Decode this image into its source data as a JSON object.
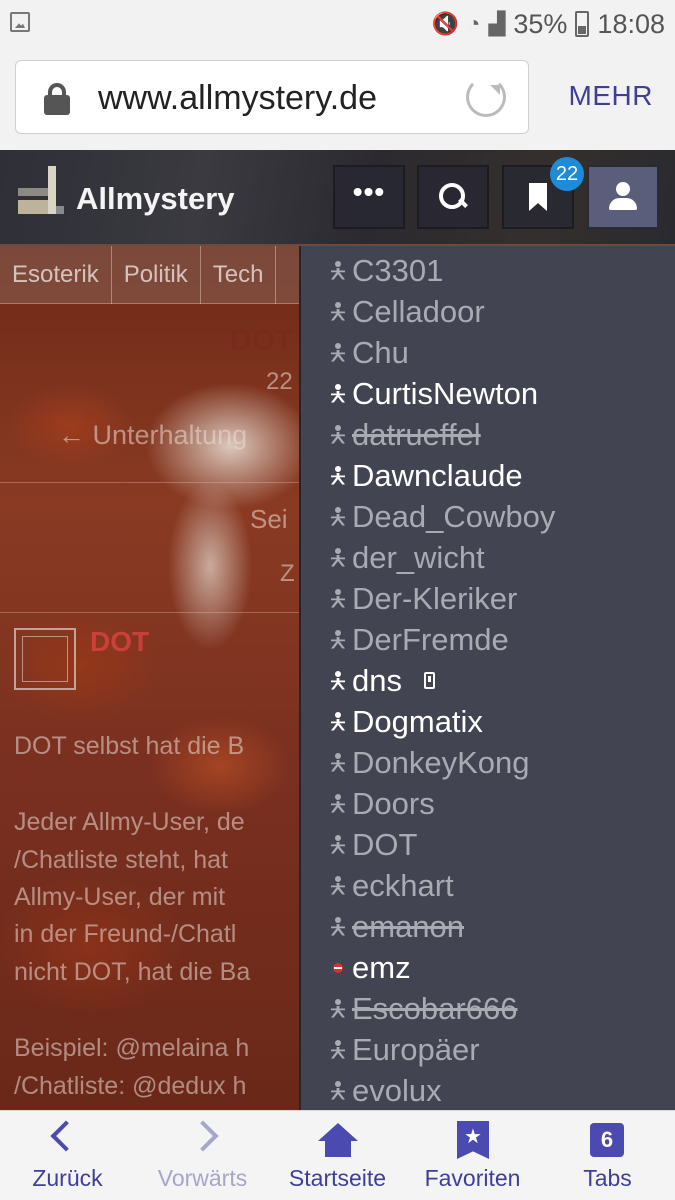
{
  "status_bar": {
    "battery": "35%",
    "time": "18:08"
  },
  "browser": {
    "url": "www.allmystery.de",
    "more_label": "MEHR"
  },
  "site": {
    "name": "Allmystery",
    "more_button": "•••",
    "notification_count": "22"
  },
  "page": {
    "categories": [
      "Esoterik",
      "Politik",
      "Tech"
    ],
    "thread_title_fragment": "DOT",
    "date_fragment": "22",
    "subforum_fragment": "← Unterhaltung",
    "pages_fragment": "Sei",
    "z_fragment": "Z",
    "post_author": "DOT",
    "post_lines": [
      "DOT selbst hat die B",
      "Jeder Allmy-User, de",
      "/Chatliste steht, hat",
      "Allmy-User, der mit",
      "in der Freund-/Chatl",
      "nicht DOT, hat die Ba",
      "Beispiel: @melaina h",
      "/Chatliste: @dedux h"
    ]
  },
  "user_list": [
    {
      "name": "C3301",
      "state": "offline"
    },
    {
      "name": "Celladoor",
      "state": "offline"
    },
    {
      "name": "Chu",
      "state": "offline"
    },
    {
      "name": "CurtisNewton",
      "state": "online"
    },
    {
      "name": "datrueffel",
      "state": "deleted"
    },
    {
      "name": "Dawnclaude",
      "state": "online"
    },
    {
      "name": "Dead_Cowboy",
      "state": "offline"
    },
    {
      "name": "der_wicht",
      "state": "offline"
    },
    {
      "name": "Der-Kleriker",
      "state": "offline"
    },
    {
      "name": "DerFremde",
      "state": "offline"
    },
    {
      "name": "dns",
      "state": "online",
      "mobile": true
    },
    {
      "name": "Dogmatix",
      "state": "online"
    },
    {
      "name": "DonkeyKong",
      "state": "offline"
    },
    {
      "name": "Doors",
      "state": "offline"
    },
    {
      "name": "DOT",
      "state": "offline"
    },
    {
      "name": "eckhart",
      "state": "offline"
    },
    {
      "name": "emanon",
      "state": "deleted"
    },
    {
      "name": "emz",
      "state": "busy"
    },
    {
      "name": "Escobar666",
      "state": "deleted"
    },
    {
      "name": "Europäer",
      "state": "offline"
    },
    {
      "name": "evolux",
      "state": "offline"
    }
  ],
  "bottom_nav": {
    "back": "Zurück",
    "forward": "Vorwärts",
    "home": "Startseite",
    "favorites": "Favoriten",
    "tabs": "Tabs",
    "tab_count": "6"
  },
  "colors": {
    "accent": "#3f3f9a",
    "badge": "#1e8bd8",
    "dropdown_bg": "#424452",
    "user_offline": "#a9aab2",
    "user_online": "#ffffff"
  }
}
